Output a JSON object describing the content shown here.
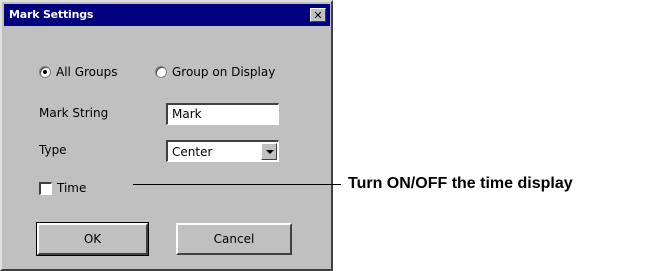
{
  "dialog": {
    "title": "Mark Settings",
    "close_glyph": "✕",
    "scope": {
      "all_groups_label": "All Groups",
      "group_on_display_label": "Group on Display",
      "selected": "All Groups"
    },
    "mark_string": {
      "label": "Mark String",
      "value": "Mark"
    },
    "type": {
      "label": "Type",
      "value": "Center"
    },
    "time": {
      "label": "Time",
      "checked": false
    },
    "ok_label": "OK",
    "cancel_label": "Cancel"
  },
  "annotation": {
    "text": "Turn ON/OFF the time display"
  },
  "colors": {
    "titlebar": "#000080",
    "dialog_bg": "#c0c0c0"
  }
}
